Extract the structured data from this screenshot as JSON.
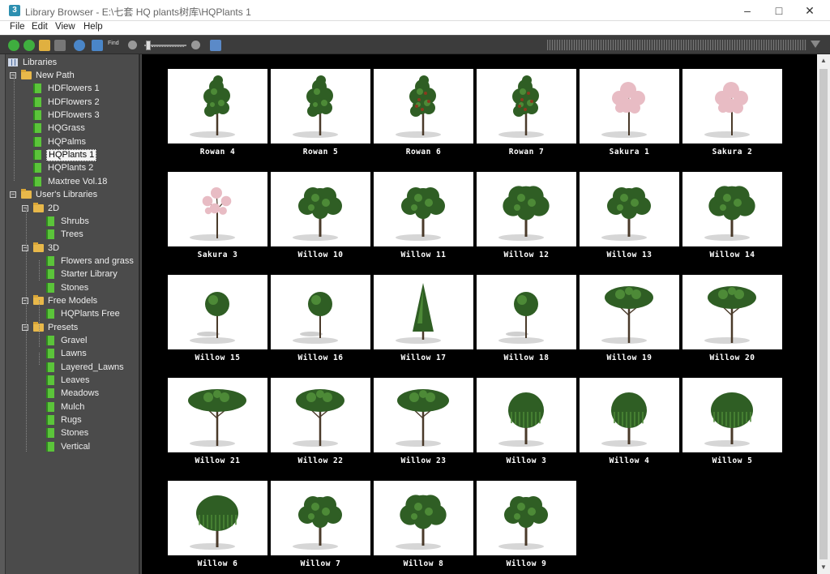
{
  "window": {
    "title": "Library Browser - E:\\七套 HQ plants树库\\HQPlants 1",
    "app_icon_letter": "3"
  },
  "menu": [
    "File",
    "Edit",
    "View",
    "Help"
  ],
  "toolbar_icons": [
    "back-icon",
    "forward-icon",
    "open-folder-icon",
    "stop-icon",
    "refresh-icon",
    "sort-icon",
    "find-icon",
    "zoom-out-icon",
    "zoom-in-icon",
    "help-icon"
  ],
  "toolbar_find_label": "Find",
  "sidebar": {
    "root_label": "Libraries",
    "items": [
      {
        "label": "New Path",
        "type": "folder",
        "level": 1,
        "expanded": true
      },
      {
        "label": "HDFlowers 1",
        "type": "book",
        "level": 2
      },
      {
        "label": "HDFlowers 2",
        "type": "book",
        "level": 2
      },
      {
        "label": "HDFlowers 3",
        "type": "book",
        "level": 2
      },
      {
        "label": "HQGrass",
        "type": "book",
        "level": 2
      },
      {
        "label": "HQPalms",
        "type": "book",
        "level": 2
      },
      {
        "label": "HQPlants 1",
        "type": "book",
        "level": 2,
        "selected": true
      },
      {
        "label": "HQPlants 2",
        "type": "book",
        "level": 2
      },
      {
        "label": "Maxtree Vol.18",
        "type": "book",
        "level": 2
      },
      {
        "label": "User's Libraries",
        "type": "folder",
        "level": 1,
        "expanded": true
      },
      {
        "label": "2D",
        "type": "folder",
        "level": 2,
        "expanded": true
      },
      {
        "label": "Shrubs",
        "type": "book",
        "level": 3
      },
      {
        "label": "Trees",
        "type": "book",
        "level": 3
      },
      {
        "label": "3D",
        "type": "folder",
        "level": 2,
        "expanded": true
      },
      {
        "label": "Flowers and grass",
        "type": "book",
        "level": 3
      },
      {
        "label": "Starter Library",
        "type": "book",
        "level": 3
      },
      {
        "label": "Stones",
        "type": "book",
        "level": 3
      },
      {
        "label": "Free Models",
        "type": "folder",
        "level": 2,
        "expanded": true
      },
      {
        "label": "HQPlants Free",
        "type": "book",
        "level": 3
      },
      {
        "label": "Presets",
        "type": "folder",
        "level": 2,
        "expanded": true
      },
      {
        "label": "Gravel",
        "type": "book",
        "level": 3
      },
      {
        "label": "Lawns",
        "type": "book",
        "level": 3
      },
      {
        "label": "Layered_Lawns",
        "type": "book",
        "level": 3
      },
      {
        "label": "Leaves",
        "type": "book",
        "level": 3
      },
      {
        "label": "Meadows",
        "type": "book",
        "level": 3
      },
      {
        "label": "Mulch",
        "type": "book",
        "level": 3
      },
      {
        "label": "Rugs",
        "type": "book",
        "level": 3
      },
      {
        "label": "Stones",
        "type": "book",
        "level": 3
      },
      {
        "label": "Vertical",
        "type": "book",
        "level": 3
      }
    ]
  },
  "thumbnails": [
    {
      "name": "Rowan 4",
      "kind": "rowan"
    },
    {
      "name": "Rowan 5",
      "kind": "rowan"
    },
    {
      "name": "Rowan 6",
      "kind": "rowan-red"
    },
    {
      "name": "Rowan 7",
      "kind": "rowan-red"
    },
    {
      "name": "Sakura 1",
      "kind": "sakura"
    },
    {
      "name": "Sakura 2",
      "kind": "sakura"
    },
    {
      "name": "Sakura 3",
      "kind": "sakura-thin"
    },
    {
      "name": "Willow 10",
      "kind": "broad"
    },
    {
      "name": "Willow 11",
      "kind": "broad"
    },
    {
      "name": "Willow 12",
      "kind": "broad-big"
    },
    {
      "name": "Willow 13",
      "kind": "broad"
    },
    {
      "name": "Willow 14",
      "kind": "broad-big"
    },
    {
      "name": "Willow 15",
      "kind": "ball"
    },
    {
      "name": "Willow 16",
      "kind": "ball"
    },
    {
      "name": "Willow 17",
      "kind": "cone"
    },
    {
      "name": "Willow 18",
      "kind": "ball"
    },
    {
      "name": "Willow 19",
      "kind": "umbrella"
    },
    {
      "name": "Willow 20",
      "kind": "umbrella"
    },
    {
      "name": "Willow 21",
      "kind": "umbrella-wide"
    },
    {
      "name": "Willow 22",
      "kind": "umbrella"
    },
    {
      "name": "Willow 23",
      "kind": "umbrella-tall"
    },
    {
      "name": "Willow 3",
      "kind": "weeping"
    },
    {
      "name": "Willow 4",
      "kind": "weeping"
    },
    {
      "name": "Willow 5",
      "kind": "weeping-wide"
    },
    {
      "name": "Willow 6",
      "kind": "weeping-wide"
    },
    {
      "name": "Willow 7",
      "kind": "broad"
    },
    {
      "name": "Willow 8",
      "kind": "broad-big"
    },
    {
      "name": "Willow 9",
      "kind": "broad"
    }
  ],
  "colors": {
    "foliage": "#2f5e24",
    "foliage_light": "#4d8a37",
    "sakura": "#e8bcc4",
    "rowan_berry": "#8a3a1e",
    "trunk": "#4a3a2a"
  }
}
